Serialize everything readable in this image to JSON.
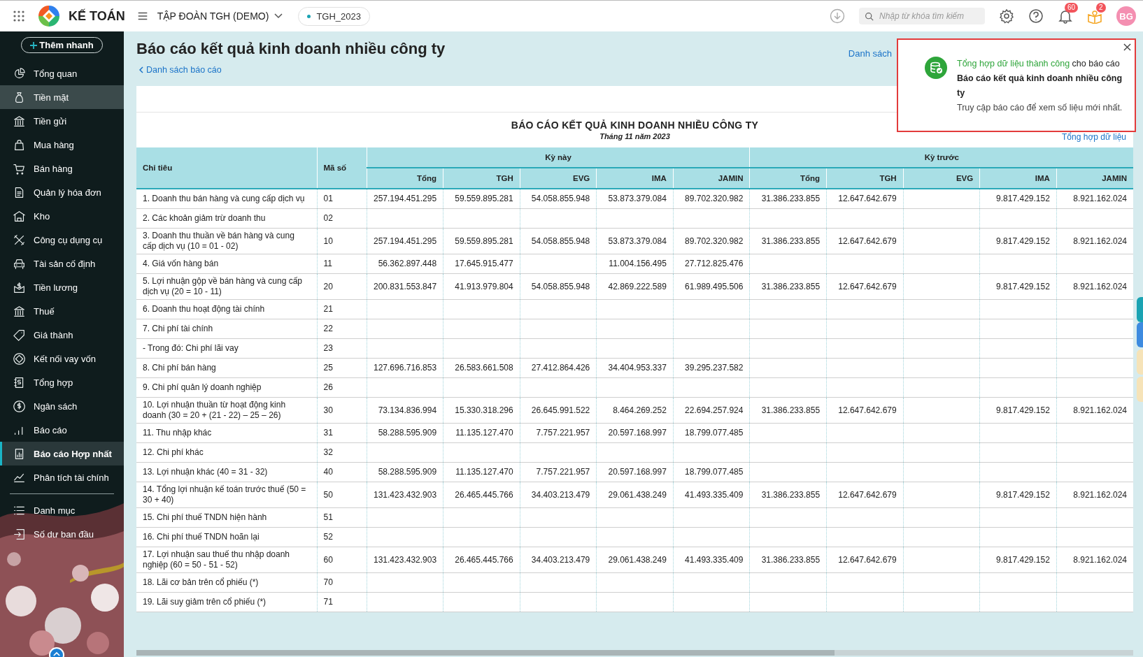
{
  "topbar": {
    "app_name": "KẾ TOÁN",
    "company": "TẬP ĐOÀN TGH (DEMO)",
    "database": "TGH_2023",
    "search": {
      "placeholder": "Nhập từ khóa tìm kiếm"
    },
    "notifications_badge": "60",
    "tips_badge": "2",
    "avatar": "BG"
  },
  "sidebar": {
    "quick_add": "Thêm nhanh",
    "items": [
      {
        "label": "Tổng quan",
        "selected": false,
        "highlighted": false
      },
      {
        "label": "Tiền mặt",
        "selected": false,
        "highlighted": true
      },
      {
        "label": "Tiền gửi",
        "selected": false,
        "highlighted": false
      },
      {
        "label": "Mua hàng",
        "selected": false,
        "highlighted": false
      },
      {
        "label": "Bán hàng",
        "selected": false,
        "highlighted": false
      },
      {
        "label": "Quản lý hóa đơn",
        "selected": false,
        "highlighted": false
      },
      {
        "label": "Kho",
        "selected": false,
        "highlighted": false
      },
      {
        "label": "Công cụ dụng cụ",
        "selected": false,
        "highlighted": false
      },
      {
        "label": "Tài sản cố định",
        "selected": false,
        "highlighted": false
      },
      {
        "label": "Tiền lương",
        "selected": false,
        "highlighted": false
      },
      {
        "label": "Thuế",
        "selected": false,
        "highlighted": false
      },
      {
        "label": "Giá thành",
        "selected": false,
        "highlighted": false
      },
      {
        "label": "Kết nối vay vốn",
        "selected": false,
        "highlighted": false
      },
      {
        "label": "Tổng hợp",
        "selected": false,
        "highlighted": false
      },
      {
        "label": "Ngân sách",
        "selected": false,
        "highlighted": false
      },
      {
        "label": "Báo cáo",
        "selected": false,
        "highlighted": false
      },
      {
        "label": "Báo cáo Hợp nhất",
        "selected": true,
        "highlighted": false
      },
      {
        "label": "Phân tích tài chính",
        "selected": false,
        "highlighted": false
      }
    ],
    "bottom_items": [
      {
        "label": "Danh mục",
        "selected": false,
        "highlighted": false
      },
      {
        "label": "Số dư ban đầu",
        "selected": false,
        "highlighted": false
      }
    ]
  },
  "page": {
    "title": "Báo cáo kết quả kinh doanh nhiều công ty",
    "back_link": "Danh sách báo cáo",
    "right_link": "Danh sách"
  },
  "toast": {
    "status": "Tổng hợp dữ liệu thành công",
    "text": "cho báo cáo",
    "report": "Báo cáo kết quả kinh doanh nhiều công ty",
    "body": "Truy cập báo cáo để xem số liệu mới nhất."
  },
  "report": {
    "title": "BÁO CÁO KẾT QUẢ KINH DOANH NHIỀU CÔNG TY",
    "subtitle": "Tháng 11 năm 2023",
    "action_link": "Tổng hợp dữ liệu"
  },
  "table": {
    "columns": [
      "Chỉ tiêu",
      "Mã số"
    ],
    "groups": [
      {
        "label": "Kỳ này",
        "columns": [
          "Tổng",
          "TGH",
          "EVG",
          "IMA",
          "JAMIN"
        ]
      },
      {
        "label": "Kỳ trước",
        "columns": [
          "Tổng",
          "TGH",
          "EVG",
          "IMA",
          "JAMIN"
        ]
      }
    ],
    "rows": [
      {
        "name": "1. Doanh thu bán hàng và cung cấp dịch vụ",
        "code": "01",
        "current": {
          "tong": "257.194.451.295",
          "tgh": "59.559.895.281",
          "evg": "54.058.855.948",
          "ima": "53.873.379.084",
          "jamin": "89.702.320.982"
        },
        "previous": {
          "tong": "31.386.233.855",
          "tgh": "12.647.642.679",
          "ima": "9.817.429.152",
          "jamin": "8.921.162.024"
        }
      },
      {
        "name": "2. Các khoản giảm trừ doanh thu",
        "code": "02"
      },
      {
        "name": "3. Doanh thu thuần về bán hàng và cung cấp dịch vụ (10 = 01 - 02)",
        "code": "10",
        "current": {
          "tong": "257.194.451.295",
          "tgh": "59.559.895.281",
          "evg": "54.058.855.948",
          "ima": "53.873.379.084",
          "jamin": "89.702.320.982"
        },
        "previous": {
          "tong": "31.386.233.855",
          "tgh": "12.647.642.679",
          "ima": "9.817.429.152",
          "jamin": "8.921.162.024"
        }
      },
      {
        "name": "4. Giá vốn hàng bán",
        "code": "11",
        "current": {
          "tong": "56.362.897.448",
          "tgh": "17.645.915.477",
          "ima": "11.004.156.495",
          "jamin": "27.712.825.476"
        }
      },
      {
        "name": "5. Lợi nhuận gộp về bán hàng và cung cấp dịch vụ (20 = 10 - 11)",
        "code": "20",
        "current": {
          "tong": "200.831.553.847",
          "tgh": "41.913.979.804",
          "evg": "54.058.855.948",
          "ima": "42.869.222.589",
          "jamin": "61.989.495.506"
        },
        "previous": {
          "tong": "31.386.233.855",
          "tgh": "12.647.642.679",
          "ima": "9.817.429.152",
          "jamin": "8.921.162.024"
        }
      },
      {
        "name": "6. Doanh thu hoạt động tài chính",
        "code": "21"
      },
      {
        "name": "7. Chi phí tài chính",
        "code": "22"
      },
      {
        "name": "- Trong đó: Chi phí lãi vay",
        "code": "23"
      },
      {
        "name": "8. Chi phí bán hàng",
        "code": "25",
        "current": {
          "tong": "127.696.716.853",
          "tgh": "26.583.661.508",
          "evg": "27.412.864.426",
          "ima": "34.404.953.337",
          "jamin": "39.295.237.582"
        }
      },
      {
        "name": "9. Chi phí quản lý doanh nghiệp",
        "code": "26"
      },
      {
        "name": "10. Lợi nhuận thuần từ hoạt động kinh doanh (30 = 20 + (21 - 22) – 25 – 26)",
        "code": "30",
        "current": {
          "tong": "73.134.836.994",
          "tgh": "15.330.318.296",
          "evg": "26.645.991.522",
          "ima": "8.464.269.252",
          "jamin": "22.694.257.924"
        },
        "previous": {
          "tong": "31.386.233.855",
          "tgh": "12.647.642.679",
          "ima": "9.817.429.152",
          "jamin": "8.921.162.024"
        }
      },
      {
        "name": "11. Thu nhập khác",
        "code": "31",
        "current": {
          "tong": "58.288.595.909",
          "tgh": "11.135.127.470",
          "evg": "7.757.221.957",
          "ima": "20.597.168.997",
          "jamin": "18.799.077.485"
        }
      },
      {
        "name": "12. Chi phí khác",
        "code": "32"
      },
      {
        "name": "13. Lợi nhuận khác (40 = 31 - 32)",
        "code": "40",
        "current": {
          "tong": "58.288.595.909",
          "tgh": "11.135.127.470",
          "evg": "7.757.221.957",
          "ima": "20.597.168.997",
          "jamin": "18.799.077.485"
        }
      },
      {
        "name": "14. Tổng lợi nhuận kế toán trước thuế (50 = 30 + 40)",
        "code": "50",
        "current": {
          "tong": "131.423.432.903",
          "tgh": "26.465.445.766",
          "evg": "34.403.213.479",
          "ima": "29.061.438.249",
          "jamin": "41.493.335.409"
        },
        "previous": {
          "tong": "31.386.233.855",
          "tgh": "12.647.642.679",
          "ima": "9.817.429.152",
          "jamin": "8.921.162.024"
        }
      },
      {
        "name": "15. Chi phí thuế TNDN hiện hành",
        "code": "51"
      },
      {
        "name": "16. Chi phí thuế TNDN hoãn lại",
        "code": "52"
      },
      {
        "name": "17. Lợi nhuận sau thuế thu nhập doanh nghiệp (60 = 50 - 51 - 52)",
        "code": "60",
        "current": {
          "tong": "131.423.432.903",
          "tgh": "26.465.445.766",
          "evg": "34.403.213.479",
          "ima": "29.061.438.249",
          "jamin": "41.493.335.409"
        },
        "previous": {
          "tong": "31.386.233.855",
          "tgh": "12.647.642.679",
          "ima": "9.817.429.152",
          "jamin": "8.921.162.024"
        }
      },
      {
        "name": "18. Lãi cơ bản trên cổ phiếu (*)",
        "code": "70"
      },
      {
        "name": "19. Lãi suy giảm trên cổ phiếu (*)",
        "code": "71"
      }
    ]
  }
}
